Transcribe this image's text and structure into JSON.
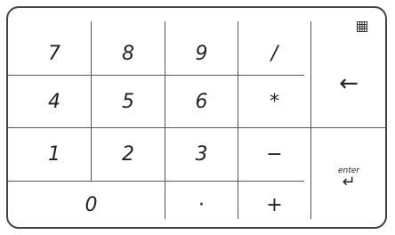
{
  "keypad": {
    "rows": [
      [
        "7",
        "8",
        "9",
        "/"
      ],
      [
        "4",
        "5",
        "6",
        "*"
      ],
      [
        "1",
        "2",
        "3",
        "−"
      ],
      [
        "0",
        "·",
        "+"
      ]
    ],
    "backspace_glyph": "←",
    "enter_label": "enter",
    "enter_glyph": "↵"
  }
}
